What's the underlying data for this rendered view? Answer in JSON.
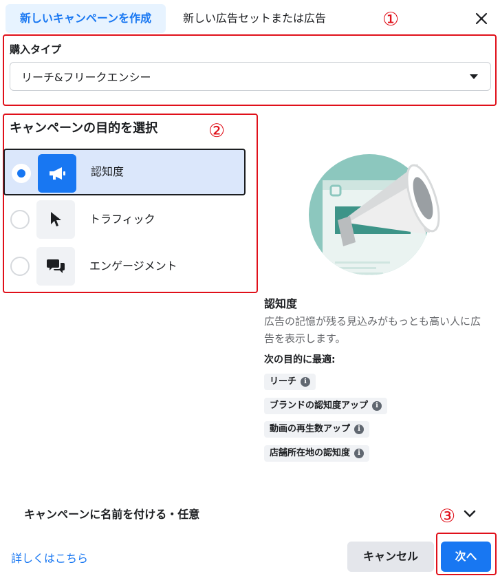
{
  "header": {
    "active_tab": "新しいキャンペーンを作成",
    "inactive_tab": "新しい広告セットまたは広告"
  },
  "annotations": {
    "one": "①",
    "two": "②",
    "three": "③"
  },
  "buying_type": {
    "label": "購入タイプ",
    "value": "リーチ&フリークエンシー"
  },
  "objectives": {
    "heading": "キャンペーンの目的を選択",
    "items": [
      {
        "label": "認知度",
        "icon": "megaphone-icon",
        "selected": true
      },
      {
        "label": "トラフィック",
        "icon": "cursor-icon",
        "selected": false
      },
      {
        "label": "エンゲージメント",
        "icon": "chat-bubbles-icon",
        "selected": false
      }
    ]
  },
  "description": {
    "title": "認知度",
    "body": "広告の記憶が残る見込みがもっとも高い人に広告を表示します。",
    "best_for_label": "次の目的に最適:",
    "chips": [
      "リーチ",
      "ブランドの認知度アップ",
      "動画の再生数アップ",
      "店舗所在地の認知度"
    ]
  },
  "campaign_name": {
    "label": "キャンペーンに名前を付ける・任意"
  },
  "footer": {
    "learn_more": "詳しくはこちら",
    "cancel": "キャンセル",
    "next": "次へ"
  },
  "colors": {
    "accent": "#1877f2",
    "annotation_red": "#e0101a",
    "selected_bg": "#dbe7fb",
    "illustration_teal": "#8cc7be"
  }
}
